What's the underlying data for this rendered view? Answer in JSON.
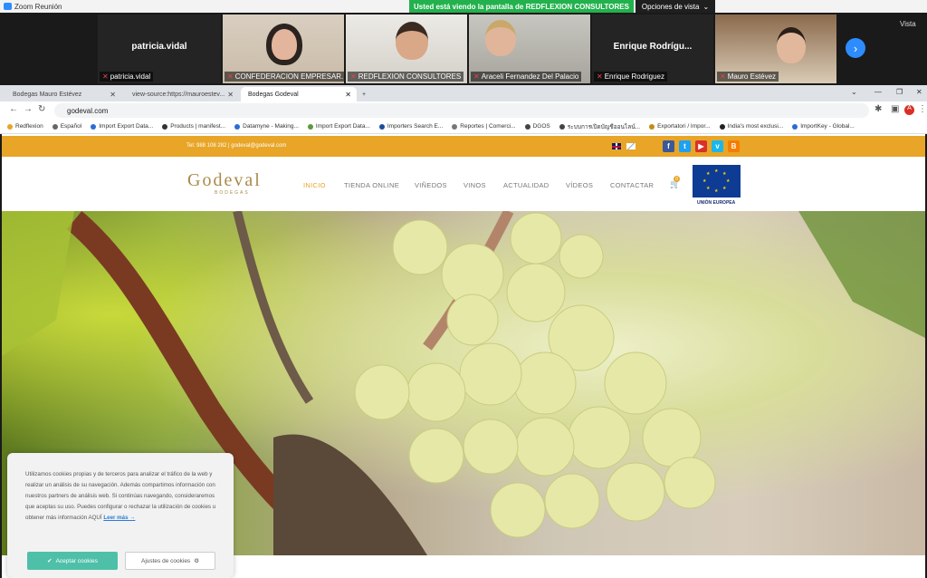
{
  "zoom": {
    "title": "Zoom Reunión",
    "banner": "Usted está viendo la pantalla de REDFLEXION CONSULTORES",
    "view_options": "Opciones de vista",
    "view_right": "Vista",
    "participants": [
      {
        "name": "patricia.vidal",
        "label": "patricia.vidal"
      },
      {
        "name": "",
        "label": "CONFEDERACION EMPRESAR..."
      },
      {
        "name": "",
        "label": "REDFLEXION CONSULTORES"
      },
      {
        "name": "",
        "label": "Araceli Fernandez Del Palacio"
      },
      {
        "name": "Enrique Rodrígu...",
        "label": "Enrique Rodriguez"
      },
      {
        "name": "",
        "label": "Mauro Estévez"
      }
    ]
  },
  "browser": {
    "tabs": [
      {
        "label": "Bodegas Mauro Estévez"
      },
      {
        "label": "view-source:https://mauroestev..."
      },
      {
        "label": "Bodegas Godeval"
      }
    ],
    "url": "godeval.com",
    "bookmarks": [
      "Redflexion",
      "Español",
      "Import Export Data...",
      "Products | manifest...",
      "Datamyne - Making...",
      "Import Export Data...",
      "Importers Search E...",
      "Reportes | Comerci...",
      "DGOS",
      "ระบบการเปิดบัญชีออนไลน์...",
      "Exportatori / Impor...",
      "India's most exclusi...",
      "ImportKey - Global..."
    ]
  },
  "site": {
    "contact": "Tel: 988 108 282 | godeval@godeval.com",
    "logo": "Godeval",
    "logo_sub": "BODEGAS",
    "menu": [
      "INICIO",
      "TIENDA ONLINE",
      "VIÑEDOS",
      "VINOS",
      "ACTUALIDAD",
      "VÍDEOS",
      "CONTACTAR"
    ],
    "cart_count": "0",
    "eu_label": "UNIÓN EUROPEA",
    "social": [
      "f",
      "t",
      "▶",
      "v",
      "B"
    ],
    "social_colors": [
      "#3b5998",
      "#1da1f2",
      "#d9302c",
      "#1ab7ea",
      "#f57d00"
    ]
  },
  "cookie": {
    "text": "Utilizamos cookies propias y de terceros para analizar el tráfico de la web y realizar un análisis de su navegación. Además compartimos información con nuestros partners de análisis web. Si continúas navegando, consideraremos que aceptas su uso. Puedes configurar o rechazar la utilización de cookies u obtener más información AQUÍ",
    "more_link": "Leer más →",
    "accept": "Aceptar cookies",
    "settings": "Ajustes de cookies"
  }
}
